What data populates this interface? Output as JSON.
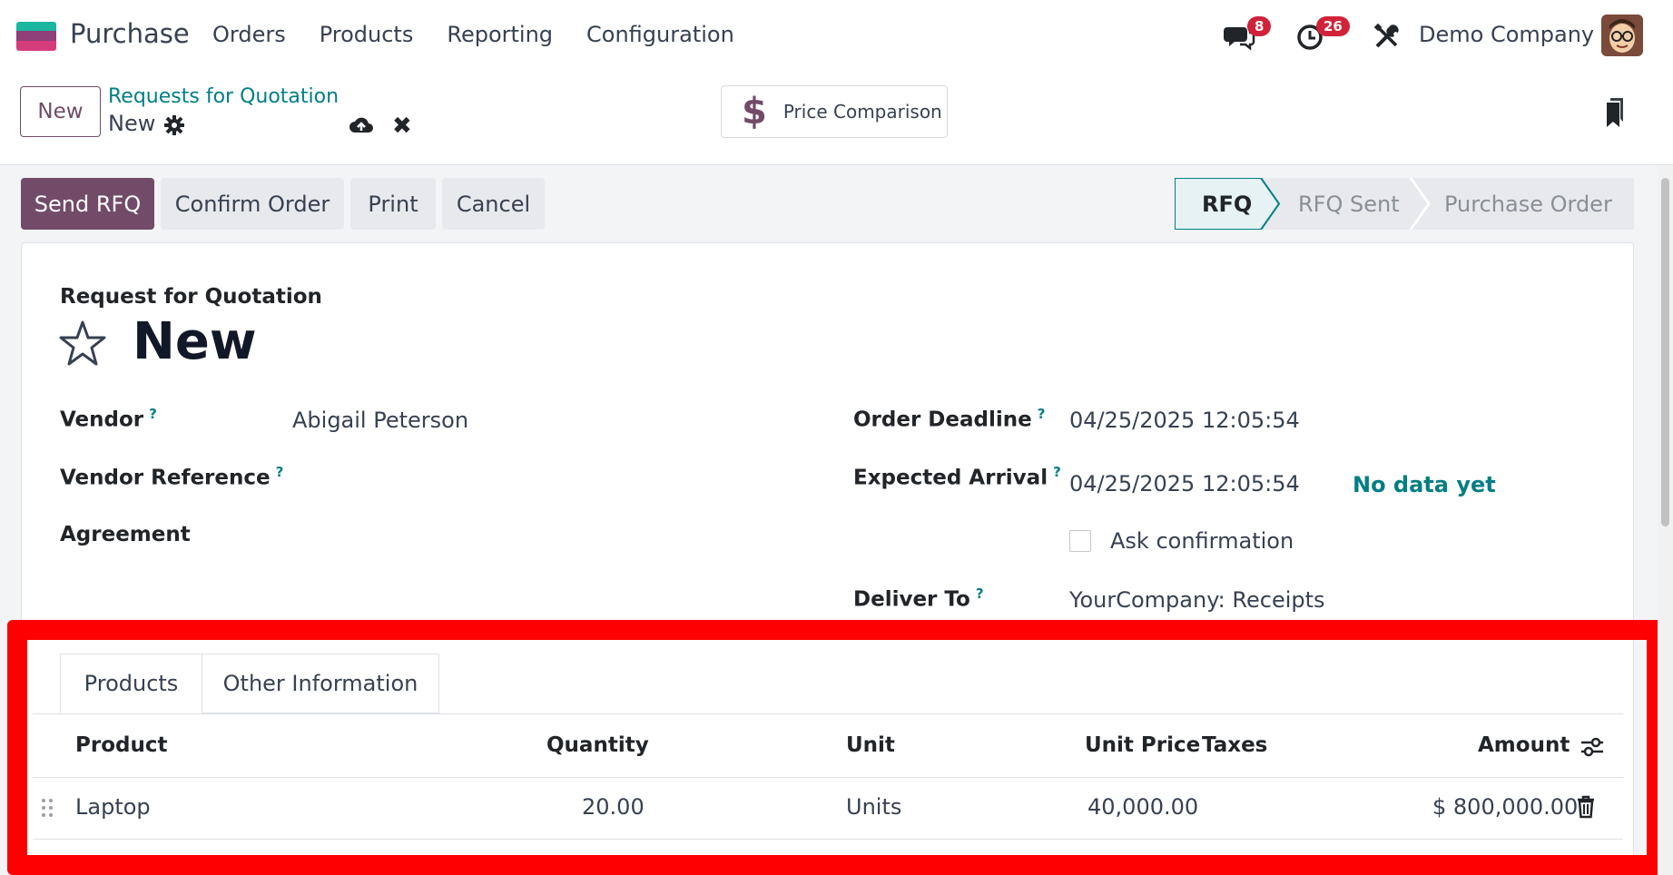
{
  "navbar": {
    "app_name": "Purchase",
    "menu": [
      "Orders",
      "Products",
      "Reporting",
      "Configuration"
    ],
    "messages_count": "8",
    "activities_count": "26",
    "company": "Demo Company"
  },
  "control_panel": {
    "new_label": "New",
    "breadcrumb_parent": "Requests for Quotation",
    "breadcrumb_current": "New",
    "price_comparison_label": "Price Comparison",
    "price_icon": "$"
  },
  "actions": {
    "send_rfq": "Send RFQ",
    "confirm_order": "Confirm Order",
    "print": "Print",
    "cancel": "Cancel"
  },
  "statusbar": {
    "steps": [
      "RFQ",
      "RFQ Sent",
      "Purchase Order"
    ],
    "active": "RFQ"
  },
  "form": {
    "title": "Request for Quotation",
    "name": "New",
    "vendor_label": "Vendor",
    "vendor_value": "Abigail Peterson",
    "vendor_ref_label": "Vendor Reference",
    "agreement_label": "Agreement",
    "order_deadline_label": "Order Deadline",
    "order_deadline_value": "04/25/2025 12:05:54",
    "expected_arrival_label": "Expected Arrival",
    "expected_arrival_value": "04/25/2025 12:05:54",
    "no_data": "No data yet",
    "ask_confirmation_label": "Ask confirmation",
    "deliver_to_label": "Deliver To",
    "deliver_to_value": "YourCompany: Receipts",
    "help_mark": "?"
  },
  "notebook": {
    "tabs": [
      "Products",
      "Other Information"
    ],
    "columns": {
      "product": "Product",
      "quantity": "Quantity",
      "unit": "Unit",
      "unit_price": "Unit Price",
      "taxes": "Taxes",
      "amount": "Amount"
    },
    "rows": [
      {
        "product": "Laptop",
        "quantity": "20.00",
        "unit": "Units",
        "unit_price": "40,000.00",
        "taxes": "",
        "amount": "$ 800,000.00"
      }
    ]
  },
  "colors": {
    "brand": "#714b67",
    "link": "#017e84",
    "highlight": "#ff0000",
    "badge": "#d0233a"
  }
}
